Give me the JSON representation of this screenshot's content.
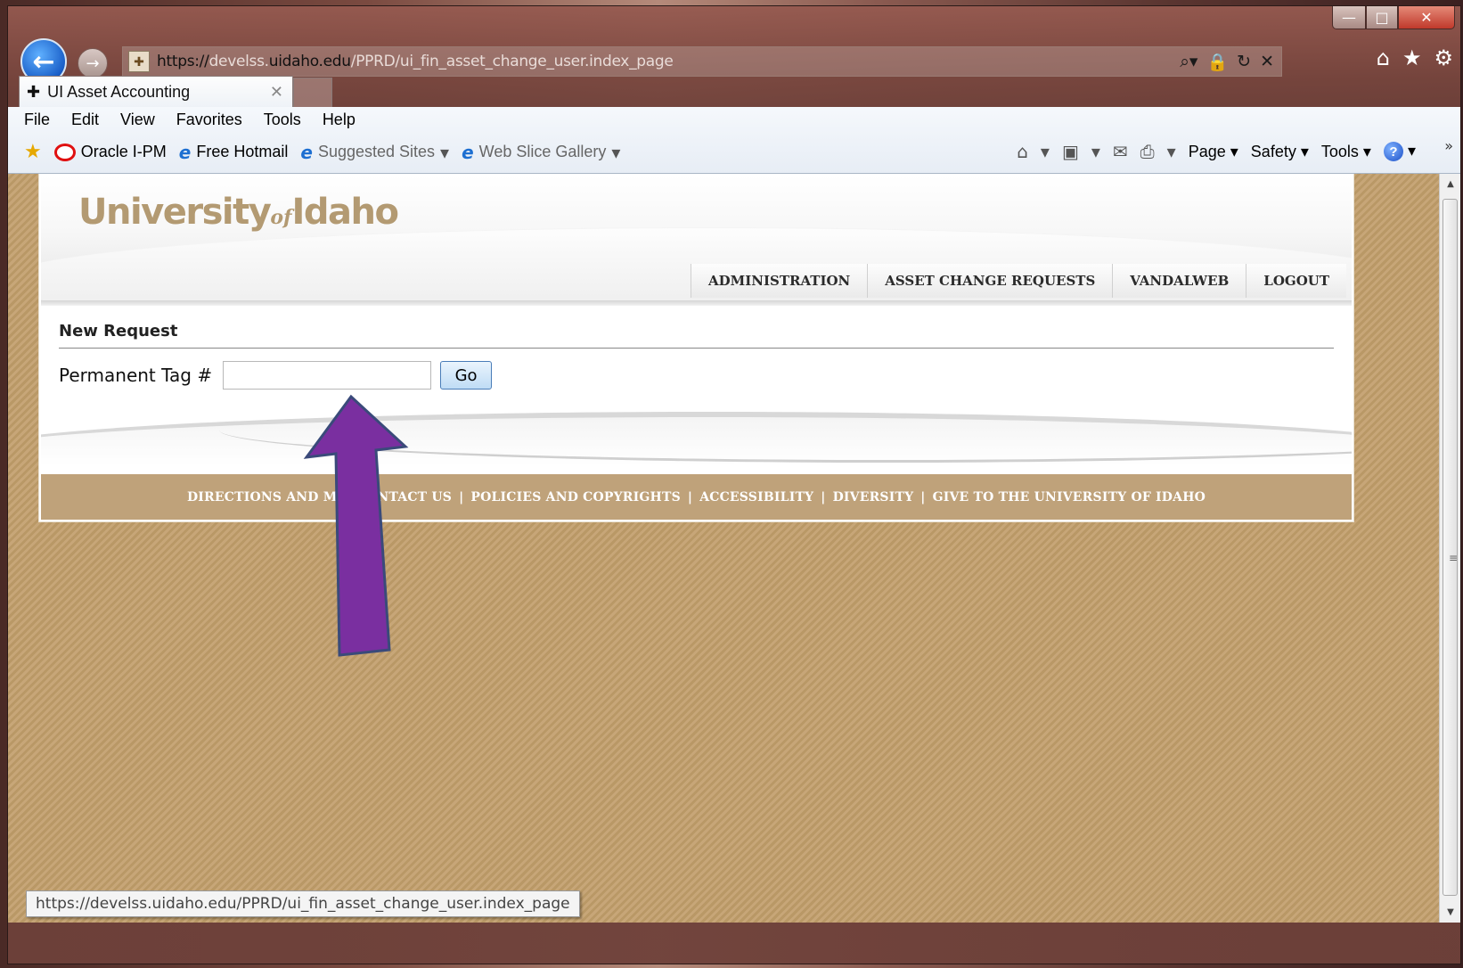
{
  "browser": {
    "url_protocol": "https://",
    "url_subdomain": "develss.",
    "url_domain": "uidaho.edu",
    "url_path": "/PPRD/ui_fin_asset_change_user.index_page",
    "tab_title": "UI Asset Accounting",
    "menu": [
      "File",
      "Edit",
      "View",
      "Favorites",
      "Tools",
      "Help"
    ],
    "favorites": {
      "oracle": "Oracle I-PM",
      "hotmail": "Free Hotmail",
      "suggested": "Suggested Sites",
      "webslice": "Web Slice Gallery"
    },
    "commands": {
      "page": "Page",
      "safety": "Safety",
      "tools": "Tools"
    },
    "status_url": "https://develss.uidaho.edu/PPRD/ui_fin_asset_change_user.index_page"
  },
  "site": {
    "logo_part1": "University",
    "logo_of": "of",
    "logo_part2": "Idaho",
    "nav": {
      "administration": "ADMINISTRATION",
      "asset_change_requests": "ASSET CHANGE REQUESTS",
      "vandalweb": "VANDALWEB",
      "logout": "LOGOUT"
    }
  },
  "form": {
    "section_title": "New Request",
    "tag_label": "Permanent Tag #",
    "tag_value": "",
    "go_label": "Go"
  },
  "footer": {
    "links": [
      "DIRECTIONS AND M",
      "CONTACT US",
      "POLICIES AND COPYRIGHTS",
      "ACCESSIBILITY",
      "DIVERSITY",
      "GIVE TO THE UNIVERSITY OF IDAHO"
    ],
    "separator": "|"
  },
  "colors": {
    "brand_gold": "#b39a72",
    "footer_bg": "#bfa27a",
    "arrow_fill": "#7a2fa0",
    "arrow_stroke": "#3a4a7a"
  }
}
